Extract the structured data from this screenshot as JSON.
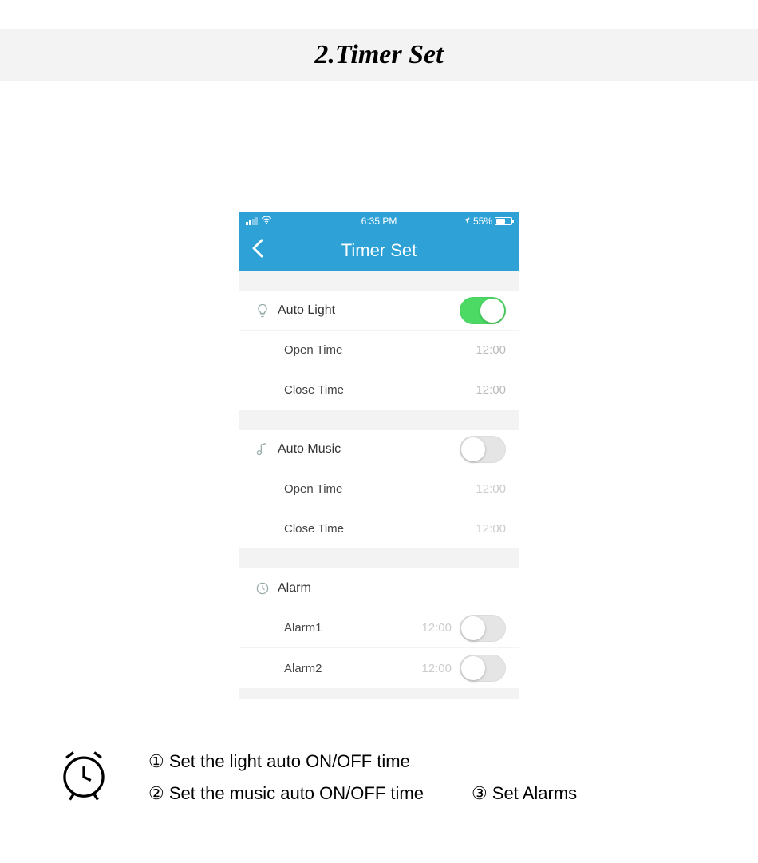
{
  "banner": {
    "title": "2.Timer Set"
  },
  "statusbar": {
    "time": "6:35 PM",
    "battery": "55%"
  },
  "navbar": {
    "title": "Timer Set"
  },
  "sections": {
    "autoLight": {
      "label": "Auto Light",
      "toggle": true,
      "open": {
        "label": "Open Time",
        "value": "12:00"
      },
      "close": {
        "label": "Close Time",
        "value": "12:00"
      }
    },
    "autoMusic": {
      "label": "Auto Music",
      "toggle": false,
      "open": {
        "label": "Open Time",
        "value": "12:00"
      },
      "close": {
        "label": "Close Time",
        "value": "12:00"
      }
    },
    "alarm": {
      "label": "Alarm",
      "alarm1": {
        "label": "Alarm1",
        "value": "12:00",
        "toggle": false
      },
      "alarm2": {
        "label": "Alarm2",
        "value": "12:00",
        "toggle": false
      }
    }
  },
  "footer": {
    "line1": "① Set the light auto ON/OFF time",
    "line2a": "② Set the music auto ON/OFF time",
    "line2b": "③ Set Alarms"
  }
}
